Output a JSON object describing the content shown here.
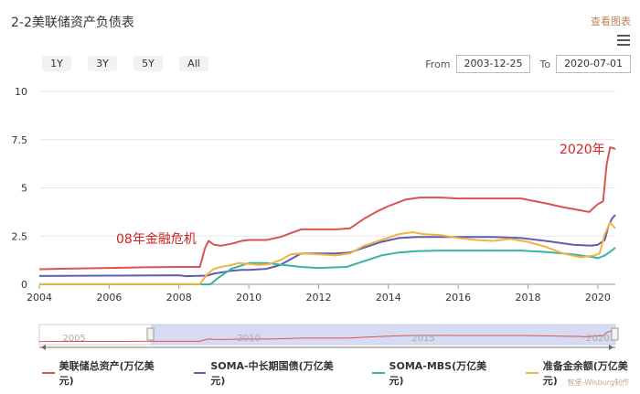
{
  "header": {
    "title": "2-2美联储资产负债表",
    "view_link": "查看图表"
  },
  "range_buttons": [
    "1Y",
    "3Y",
    "5Y",
    "All"
  ],
  "date_range": {
    "from_label": "From",
    "from": "2003-12-25",
    "to_label": "To",
    "to": "2020-07-01"
  },
  "annotations": {
    "crisis": "08年金融危机",
    "covid": "2020年"
  },
  "navigator": {
    "ticks": [
      "2005",
      "2010",
      "2015",
      "2020"
    ]
  },
  "credit": "智堡-Wisburg制作",
  "colors": {
    "total": "#d9534f",
    "treasury": "#5b5fb0",
    "mbs": "#3bb3a0",
    "reserves": "#f0b442"
  },
  "chart_data": {
    "type": "line",
    "x_axis": {
      "ticks": [
        "2004",
        "2006",
        "2008",
        "2010",
        "2012",
        "2014",
        "2016",
        "2018",
        "2020"
      ],
      "range": [
        2004,
        2020.5
      ]
    },
    "y_axis": {
      "ticks": [
        "0",
        "2.5",
        "5",
        "7.5",
        "10"
      ],
      "range": [
        0,
        10
      ]
    },
    "legend": "bottom",
    "series": [
      {
        "name": "美联储总资产(万亿美元)",
        "color": "#d9534f",
        "x": [
          2004,
          2005,
          2006,
          2007,
          2008,
          2008.6,
          2008.75,
          2008.85,
          2009.0,
          2009.2,
          2009.5,
          2009.8,
          2010.0,
          2010.5,
          2010.9,
          2011.2,
          2011.5,
          2012.0,
          2012.5,
          2012.9,
          2013.3,
          2013.7,
          2014.0,
          2014.5,
          2014.9,
          2015.5,
          2016.0,
          2017.0,
          2017.8,
          2018.5,
          2019.0,
          2019.6,
          2019.75,
          2019.9,
          2020.0,
          2020.15,
          2020.25,
          2020.35,
          2020.45,
          2020.5
        ],
        "y": [
          0.78,
          0.82,
          0.85,
          0.88,
          0.9,
          0.9,
          1.9,
          2.25,
          2.05,
          2.0,
          2.1,
          2.25,
          2.3,
          2.3,
          2.45,
          2.65,
          2.85,
          2.85,
          2.85,
          2.9,
          3.4,
          3.8,
          4.05,
          4.4,
          4.5,
          4.5,
          4.45,
          4.45,
          4.45,
          4.2,
          4.0,
          3.8,
          3.75,
          4.0,
          4.15,
          4.3,
          6.2,
          7.1,
          7.05,
          7.0
        ]
      },
      {
        "name": "SOMA-中长期国债(万亿美元)",
        "color": "#5b5fb0",
        "x": [
          2004,
          2006,
          2008.0,
          2008.2,
          2008.8,
          2009.0,
          2009.5,
          2009.8,
          2010.0,
          2010.5,
          2010.9,
          2011.3,
          2011.5,
          2012.0,
          2012.5,
          2012.9,
          2013.3,
          2013.8,
          2014.3,
          2014.8,
          2015.5,
          2016.0,
          2017.0,
          2017.8,
          2018.5,
          2019.3,
          2019.8,
          2020.0,
          2020.2,
          2020.3,
          2020.4,
          2020.5
        ],
        "y": [
          0.43,
          0.45,
          0.47,
          0.42,
          0.45,
          0.55,
          0.7,
          0.75,
          0.75,
          0.8,
          1.0,
          1.4,
          1.6,
          1.6,
          1.6,
          1.65,
          1.9,
          2.2,
          2.4,
          2.45,
          2.45,
          2.45,
          2.45,
          2.4,
          2.25,
          2.05,
          2.0,
          2.05,
          2.3,
          3.0,
          3.4,
          3.6
        ]
      },
      {
        "name": "SOMA-MBS(万亿美元)",
        "color": "#3bb3a0",
        "x": [
          2004,
          2008.9,
          2009.1,
          2009.5,
          2010.0,
          2010.5,
          2011.0,
          2011.5,
          2012.0,
          2012.8,
          2013.3,
          2013.8,
          2014.3,
          2014.8,
          2015.5,
          2017.0,
          2017.8,
          2018.5,
          2019.3,
          2019.9,
          2020.0,
          2020.2,
          2020.4,
          2020.5
        ],
        "y": [
          0,
          0,
          0.3,
          0.8,
          1.1,
          1.1,
          1.0,
          0.9,
          0.85,
          0.9,
          1.2,
          1.5,
          1.65,
          1.72,
          1.75,
          1.75,
          1.75,
          1.68,
          1.55,
          1.4,
          1.35,
          1.5,
          1.75,
          1.9
        ]
      },
      {
        "name": "准备金余额(万亿美元)",
        "color": "#f0b442",
        "x": [
          2004,
          2008.6,
          2008.8,
          2009.0,
          2009.2,
          2009.5,
          2009.7,
          2010.0,
          2010.3,
          2010.6,
          2010.9,
          2011.2,
          2011.5,
          2012.0,
          2012.5,
          2012.9,
          2013.3,
          2013.8,
          2014.3,
          2014.7,
          2015.0,
          2015.5,
          2016.0,
          2016.5,
          2017.0,
          2017.5,
          2018.0,
          2018.5,
          2019.0,
          2019.5,
          2019.9,
          2020.05,
          2020.2,
          2020.35,
          2020.45,
          2020.5
        ],
        "y": [
          0.01,
          0.01,
          0.5,
          0.8,
          0.9,
          1.0,
          1.1,
          1.05,
          1.0,
          1.05,
          1.25,
          1.55,
          1.6,
          1.55,
          1.5,
          1.6,
          2.0,
          2.3,
          2.6,
          2.7,
          2.6,
          2.55,
          2.4,
          2.3,
          2.25,
          2.35,
          2.2,
          1.95,
          1.6,
          1.4,
          1.5,
          1.6,
          2.6,
          3.2,
          3.0,
          2.9
        ]
      }
    ]
  }
}
